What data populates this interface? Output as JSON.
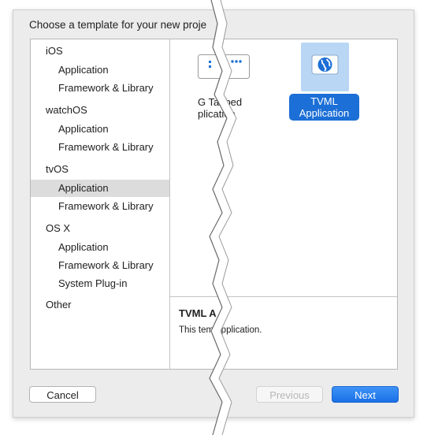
{
  "dialog": {
    "title": "Choose a template for your new proje"
  },
  "sidebar": {
    "items": [
      {
        "label": "iOS",
        "kind": "head"
      },
      {
        "label": "Application",
        "kind": "item"
      },
      {
        "label": "Framework & Library",
        "kind": "item"
      },
      {
        "label": "watchOS",
        "kind": "head"
      },
      {
        "label": "Application",
        "kind": "item"
      },
      {
        "label": "Framework & Library",
        "kind": "item"
      },
      {
        "label": "tvOS",
        "kind": "head"
      },
      {
        "label": "Application",
        "kind": "item",
        "selected": true
      },
      {
        "label": "Framework & Library",
        "kind": "item"
      },
      {
        "label": "OS X",
        "kind": "head"
      },
      {
        "label": "Application",
        "kind": "item"
      },
      {
        "label": "Framework & Library",
        "kind": "item"
      },
      {
        "label": "System Plug-in",
        "kind": "item"
      },
      {
        "label": "Other",
        "kind": "head"
      }
    ]
  },
  "templates": [
    {
      "label_line1": "G  Tabbed",
      "label_line2": "  plication",
      "icon": "tabbed-icon",
      "selected": false
    },
    {
      "label_line1": "TVML",
      "label_line2": "Application",
      "icon": "globe-icon",
      "selected": true
    }
  ],
  "description": {
    "title": "TVML A",
    "text": "This tem   application."
  },
  "buttons": {
    "cancel": "Cancel",
    "previous": "Previous",
    "next": "Next"
  },
  "colors": {
    "accent": "#1c6fd6",
    "icon_bg": "#bad6f5",
    "icon_globe": "#1c6fd6"
  }
}
